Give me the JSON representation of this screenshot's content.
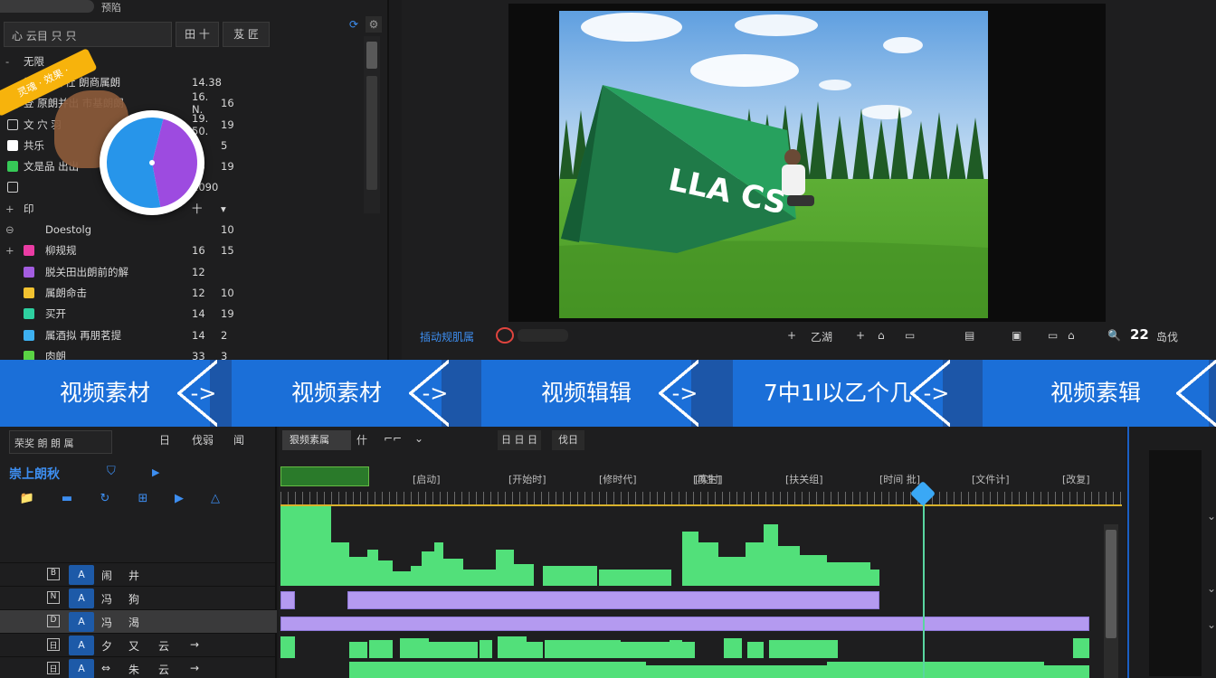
{
  "project": {
    "tab_label": "预陷",
    "search_placeholder": "心 云目 只 只",
    "add_label": "田 十",
    "list_label": "芨 匠",
    "sync_icon": "sync-icon",
    "settings_icon": "settings-icon",
    "sticker_text": "灵魂 · 效果 ·",
    "items": [
      {
        "name": "无限",
        "v1": "",
        "v2": "",
        "check": "none",
        "indent": false,
        "expand": "-"
      },
      {
        "name": "属部朗外社 朗商属朗",
        "v1": "14.38",
        "v2": "",
        "check": "none",
        "indent": false,
        "expand": ""
      },
      {
        "name": "登 原朗并出 市基朗朗",
        "v1": "16. N.",
        "v2": "16",
        "check": "green",
        "indent": false,
        "expand": ""
      },
      {
        "name": "文 穴 羽",
        "v1": "19. 50.",
        "v2": "19",
        "check": "outline",
        "indent": false,
        "expand": ""
      },
      {
        "name": "共乐",
        "v1": "8",
        "v2": "5",
        "check": "white",
        "indent": false,
        "expand": ""
      },
      {
        "name": "文是品  出出",
        "v1": "18",
        "v2": "19",
        "check": "green",
        "indent": false,
        "expand": ""
      },
      {
        "name": "",
        "v1": "1090",
        "v2": "",
        "check": "outline",
        "indent": false,
        "expand": ""
      },
      {
        "name": "印",
        "v1": "十",
        "v2": "▾",
        "check": "none",
        "indent": false,
        "expand": "+"
      },
      {
        "name": "Doestolg",
        "v1": "",
        "v2": "10",
        "check": "none",
        "indent": true,
        "expand": "⊖"
      },
      {
        "name": "柳规规",
        "v1": "16",
        "v2": "15",
        "check": "none",
        "indent": true,
        "expand": "+",
        "swatch": "#ea3ca3"
      },
      {
        "name": "脱关田出朗前的解",
        "v1": "12",
        "v2": "",
        "check": "none",
        "indent": true,
        "expand": "",
        "swatch": "#a35de0"
      },
      {
        "name": "属朗命击",
        "v1": "12",
        "v2": "10",
        "check": "none",
        "indent": true,
        "expand": "",
        "swatch": "#f2c230"
      },
      {
        "name": "买开",
        "v1": "14",
        "v2": "19",
        "check": "none",
        "indent": true,
        "expand": "",
        "swatch": "#2ed0a0"
      },
      {
        "name": "属酒拟 再朋茗提",
        "v1": "14",
        "v2": "2",
        "check": "none",
        "indent": true,
        "expand": "",
        "swatch": "#3db0f0"
      },
      {
        "name": "肉朗",
        "v1": "33",
        "v2": "3",
        "check": "none",
        "indent": true,
        "expand": "",
        "swatch": "#5ad444"
      }
    ],
    "pie": {
      "blue": 0.57,
      "purple": 0.43
    }
  },
  "preview": {
    "tent_text": "LLA CS",
    "controls": {
      "label": "插动规肌属",
      "mid": "乙湖",
      "zoom": "22",
      "zoom_suffix": "岛伐"
    }
  },
  "workflow": {
    "steps": [
      "视频素材",
      "视频素材",
      "视频辑辑",
      "7中1I以乙个几",
      "视频素辑"
    ],
    "arrow": "->"
  },
  "effects": {
    "search_value": "荣奖 朗 朗 属",
    "icon_labels": [
      "日",
      "伐弱",
      "闻"
    ],
    "title": "崇上朗秋",
    "tools": [
      "📁",
      "▬",
      "↻",
      "⊞",
      "▶",
      "△"
    ]
  },
  "track_headers": [
    {
      "lock": "B",
      "target": "A",
      "name": "闹",
      "m": "井",
      "s": "",
      "x": "",
      "selected": false
    },
    {
      "lock": "N",
      "target": "A",
      "name": "冯",
      "m": "狗",
      "s": "",
      "x": "",
      "selected": false
    },
    {
      "lock": "D",
      "target": "A",
      "name": "冯",
      "m": "渴",
      "s": "",
      "x": "",
      "selected": true
    },
    {
      "lock": "日",
      "target": "A",
      "name": "夕",
      "m": "又",
      "s": "云",
      "x": "→",
      "selected": false
    },
    {
      "lock": "日",
      "target": "A",
      "name": "⇔",
      "m": "朱",
      "s": "云",
      "x": "→",
      "selected": false
    }
  ],
  "timeline": {
    "tab_label": "狠频素属",
    "tab_icons": [
      "什",
      "⌐⌐",
      "⌄"
    ],
    "tab2": "日 日 日",
    "tab3": "伐日",
    "ruler_labels": [
      "[启动]",
      "[开始时]",
      "[修时代]",
      "[实时]",
      "[再生]",
      "[扶关组]",
      "[时间 批]",
      "[文件计]",
      "[改复]"
    ],
    "playhead_frac": 0.763
  },
  "colors": {
    "accent": "#1b6fd8",
    "clip_green": "#52e07a",
    "clip_purple": "#b49af0",
    "playhead": "#3aa8f5"
  }
}
